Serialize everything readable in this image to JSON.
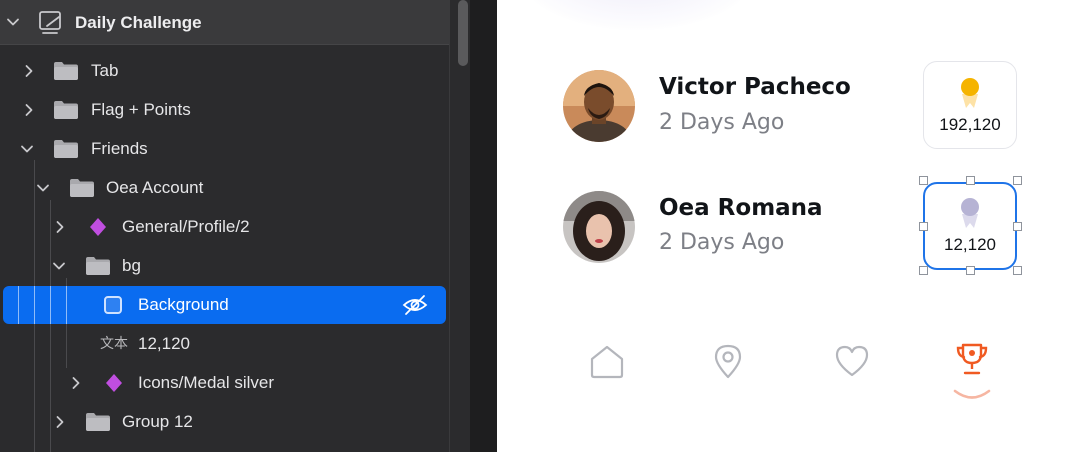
{
  "layers": {
    "root": {
      "label": "Daily Challenge",
      "icon": "artboard-icon"
    },
    "items": [
      {
        "label": "Tab",
        "icon": "folder-icon"
      },
      {
        "label": "Flag + Points",
        "icon": "folder-icon"
      },
      {
        "label": "Friends",
        "icon": "folder-icon"
      },
      {
        "label": "Oea Account",
        "icon": "folder-icon"
      },
      {
        "label": "General/Profile/2",
        "icon": "symbol-icon"
      },
      {
        "label": "bg",
        "icon": "folder-icon"
      },
      {
        "label": "Background",
        "icon": "rectangle-icon",
        "selected": true
      },
      {
        "label": "12,120",
        "icon": "text-layer-icon",
        "icon_text": "文本"
      },
      {
        "label": "Icons/Medal silver",
        "icon": "symbol-icon"
      },
      {
        "label": "Group 12",
        "icon": "folder-icon"
      }
    ]
  },
  "canvas": {
    "entries": [
      {
        "name": "Victor Pacheco",
        "time": "2 Days Ago",
        "score": "192,120",
        "medal": "gold"
      },
      {
        "name": "Oea Romana",
        "time": "2 Days Ago",
        "score": "12,120",
        "medal": "silver"
      }
    ],
    "nav": [
      "home-icon",
      "location-pin-icon",
      "heart-icon",
      "trophy-icon"
    ],
    "active_nav": "trophy-icon"
  },
  "colors": {
    "selection": "#0a6cf0",
    "accent": "#f05a22",
    "gold": "#f5b400",
    "silver": "#b6b3d4",
    "symbol": "#c04ee0"
  }
}
